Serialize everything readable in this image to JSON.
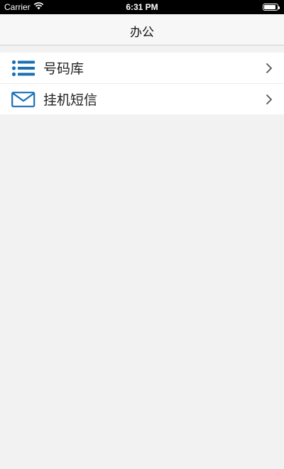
{
  "status_bar": {
    "carrier": "Carrier",
    "time": "6:31 PM",
    "wifi_icon": "wifi-icon",
    "battery_icon": "battery-icon",
    "battery_level": 0.9
  },
  "nav": {
    "title": "办公"
  },
  "menu": {
    "items": [
      {
        "label": "号码库",
        "icon": "list-icon",
        "accent": "#1a6fb5"
      },
      {
        "label": "挂机短信",
        "icon": "envelope-icon",
        "accent": "#1a6fb5"
      }
    ],
    "chevron_icon": "chevron-right-icon"
  }
}
